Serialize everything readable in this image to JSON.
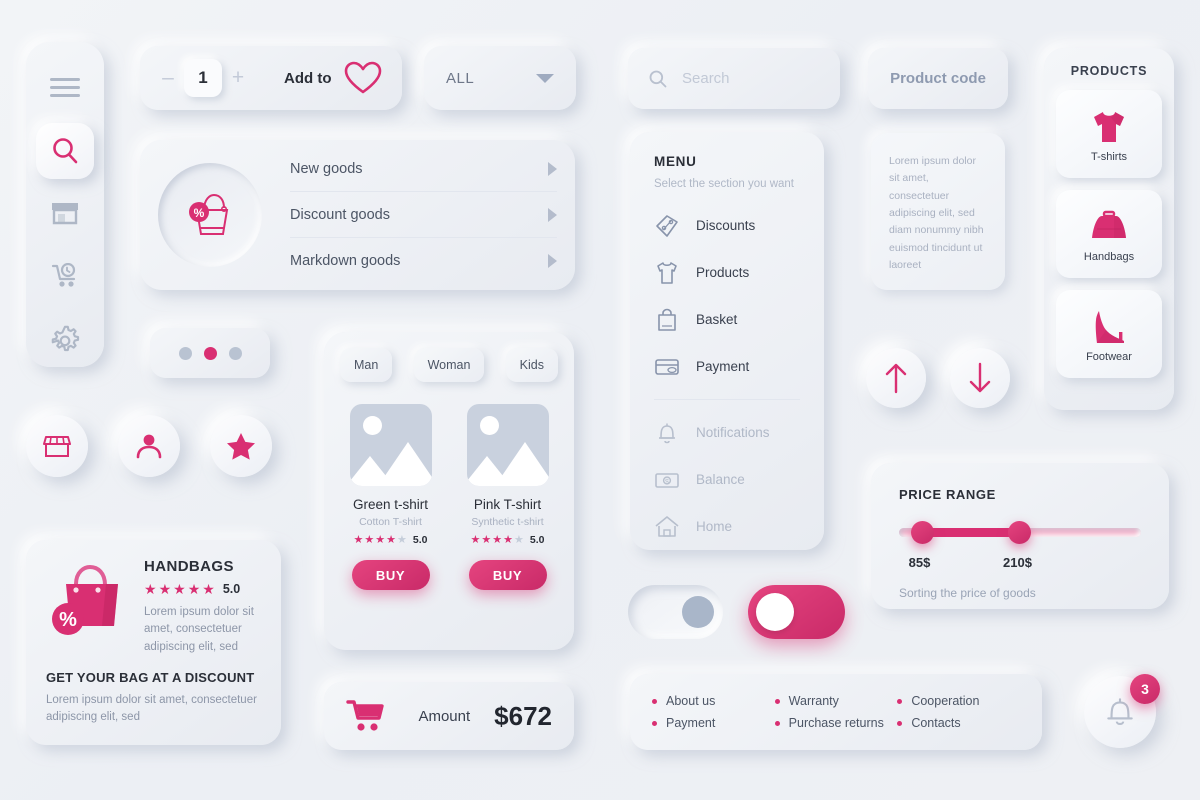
{
  "colors": {
    "accent": "#d92f72",
    "accent_dark": "#c92a68",
    "bg": "#eff1f5",
    "text_dark": "#2b2f38",
    "text_muted": "#a9b1c1"
  },
  "sidebar": {
    "items": [
      {
        "name": "menu-icon",
        "label": "Menu",
        "active": false
      },
      {
        "name": "search-icon",
        "label": "Search",
        "active": true
      },
      {
        "name": "store-icon",
        "label": "Store",
        "active": false
      },
      {
        "name": "cart-icon",
        "label": "Cart",
        "active": false
      },
      {
        "name": "gear-icon",
        "label": "Settings",
        "active": false
      }
    ]
  },
  "stepper": {
    "minus": "–",
    "plus": "+",
    "quantity": "1",
    "add_to_label": "Add to",
    "heart_icon": "heart-icon"
  },
  "dropdown": {
    "value": "ALL",
    "caret": "chevron-down-icon"
  },
  "search": {
    "placeholder": "Search",
    "value": "",
    "icon": "search-icon"
  },
  "product_code": {
    "label": "Product code"
  },
  "goods": {
    "badge_icon": "discount-bag-icon",
    "rows": [
      {
        "label": "New goods"
      },
      {
        "label": "Discount goods"
      },
      {
        "label": "Markdown goods"
      }
    ]
  },
  "dots": {
    "count": 3,
    "active_index": 1
  },
  "round_buttons": [
    {
      "name": "store-icon",
      "label": "Store"
    },
    {
      "name": "user-icon",
      "label": "Profile"
    },
    {
      "name": "star-icon",
      "label": "Favorites"
    }
  ],
  "promo": {
    "icon": "handbag-discount-icon",
    "title": "HANDBAGS",
    "rating": {
      "filled": 5,
      "total": 5,
      "score": "5.0"
    },
    "description": "Lorem ipsum dolor sit amet, consectetuer adipiscing elit, sed",
    "headline": "GET YOUR BAG AT A DISCOUNT",
    "subtext": "Lorem ipsum dolor sit amet, consectetuer adipiscing elit, sed"
  },
  "shop": {
    "tabs": [
      {
        "label": "Man"
      },
      {
        "label": "Woman"
      },
      {
        "label": "Kids"
      }
    ],
    "products": [
      {
        "image_icon": "image-placeholder-icon",
        "name": "Green t-shirt",
        "subtitle": "Cotton T-shirt",
        "rating": {
          "filled": 4,
          "total": 5,
          "score": "5.0"
        },
        "buy_label": "BUY"
      },
      {
        "image_icon": "image-placeholder-icon",
        "name": "Pink T-shirt",
        "subtitle": "Synthetic t-shirt",
        "rating": {
          "filled": 4,
          "total": 5,
          "score": "5.0"
        },
        "buy_label": "BUY"
      }
    ]
  },
  "amount": {
    "icon": "cart-icon",
    "label": "Amount",
    "value": "$672"
  },
  "menu": {
    "title": "MENU",
    "subtitle": "Select the section you want",
    "primary_items": [
      {
        "icon": "discount-tag-icon",
        "label": "Discounts"
      },
      {
        "icon": "tshirt-icon",
        "label": "Products"
      },
      {
        "icon": "basket-icon",
        "label": "Basket"
      },
      {
        "icon": "card-icon",
        "label": "Payment"
      }
    ],
    "secondary_items": [
      {
        "icon": "bell-icon",
        "label": "Notifications"
      },
      {
        "icon": "money-icon",
        "label": "Balance"
      },
      {
        "icon": "home-icon",
        "label": "Home"
      }
    ]
  },
  "lorem_card": {
    "text": "Lorem ipsum dolor sit amet, consectetuer adipiscing elit, sed diam nonummy nibh euismod tincidunt ut laoreet"
  },
  "arrows": [
    {
      "name": "arrow-up-icon",
      "label": "Sort ascending"
    },
    {
      "name": "arrow-down-icon",
      "label": "Sort descending"
    }
  ],
  "price_range": {
    "title": "PRICE RANGE",
    "min_value": "85$",
    "max_value": "210$",
    "note": "Sorting the price of goods"
  },
  "toggles": [
    {
      "name": "toggle-off",
      "state": "off"
    },
    {
      "name": "toggle-on",
      "state": "on"
    }
  ],
  "footer_links": [
    {
      "label": "About us"
    },
    {
      "label": "Warranty"
    },
    {
      "label": "Cooperation"
    },
    {
      "label": "Payment"
    },
    {
      "label": "Purchase returns"
    },
    {
      "label": "Contacts"
    }
  ],
  "products_panel": {
    "title": "PRODUCTS",
    "items": [
      {
        "icon": "tshirt-icon",
        "label": "T-shirts"
      },
      {
        "icon": "handbag-icon",
        "label": "Handbags"
      },
      {
        "icon": "heel-shoe-icon",
        "label": "Footwear"
      }
    ]
  },
  "notification": {
    "icon": "bell-icon",
    "count": "3"
  }
}
